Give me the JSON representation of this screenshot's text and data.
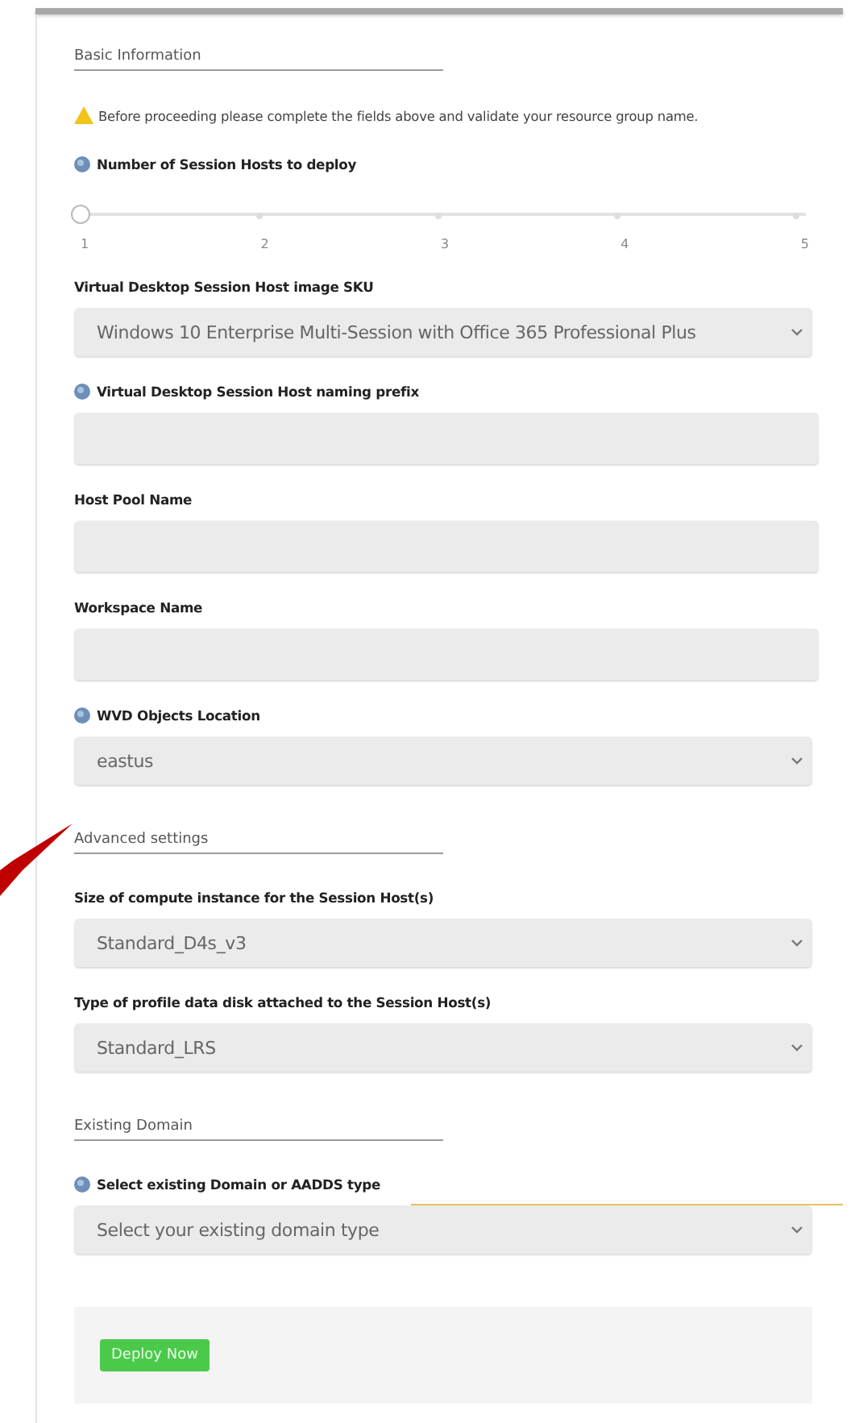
{
  "items": [
    {
      "kind": "section",
      "title": "Basic Information"
    },
    {
      "kind": "notice",
      "text": "Before proceeding please complete the fields above and validate your resource group name."
    },
    {
      "kind": "slider",
      "label": "Number of Session Hosts to deploy",
      "info": true,
      "level": 0,
      "ticks": [
        "1",
        "2",
        "3",
        "4",
        "5"
      ]
    },
    {
      "kind": "select",
      "label": "Virtual Desktop Session Host image SKU",
      "info": false,
      "value": "Windows 10 Enterprise Multi-Session with Office 365 Professional Plus"
    },
    {
      "kind": "text",
      "label": "Virtual Desktop Session Host naming prefix",
      "info": true
    },
    {
      "kind": "text",
      "label": "Host Pool Name",
      "info": false
    },
    {
      "kind": "text",
      "label": "Workspace Name",
      "info": false
    },
    {
      "kind": "select",
      "label": "WVD Objects Location",
      "info": true,
      "value": "eastus"
    },
    {
      "kind": "section",
      "title": "Advanced settings",
      "pointer": true
    },
    {
      "kind": "select",
      "label": "Size of compute instance for the Session Host(s)",
      "info": false,
      "value": "Standard_D4s_v3"
    },
    {
      "kind": "select",
      "label": "Type of profile data disk attached to the Session Host(s)",
      "info": false,
      "value": "Standard_LRS"
    },
    {
      "kind": "section",
      "title": "Existing Domain"
    },
    {
      "kind": "select",
      "label": "Select existing Domain or AADDS type",
      "info": true,
      "value": "Select your existing domain type",
      "highlight": true
    }
  ],
  "deploy_button": "Deploy Now"
}
